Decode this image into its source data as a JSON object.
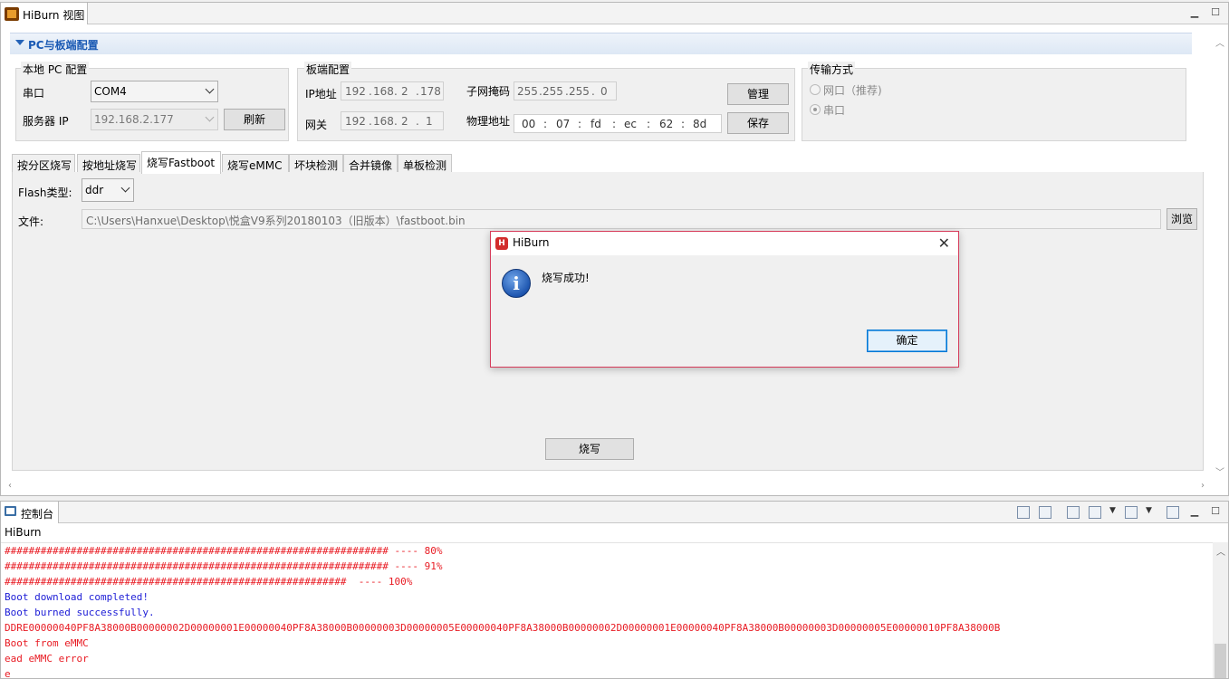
{
  "view": {
    "tab_title": "HiBurn 视图",
    "section_title": "PC与板端配置"
  },
  "local_pc": {
    "legend": "本地 PC 配置",
    "serial_label": "串口",
    "serial_value": "COM4",
    "server_ip_label": "服务器 IP",
    "server_ip_value": "192.168.2.177",
    "refresh_button": "刷新"
  },
  "board": {
    "legend": "板端配置",
    "ip_label": "IP地址",
    "ip": [
      "192",
      "168",
      "2",
      "178"
    ],
    "gateway_label": "网关",
    "gateway": [
      "192",
      "168",
      "2",
      "1"
    ],
    "subnet_label": "子网掩码",
    "subnet": [
      "255",
      "255",
      "255",
      "0"
    ],
    "mac_label": "物理地址",
    "mac": [
      "00",
      "07",
      "fd",
      "ec",
      "62",
      "8d"
    ],
    "manage_button": "管理",
    "save_button": "保存"
  },
  "transport": {
    "legend": "传输方式",
    "options": [
      {
        "label": "网口（推荐)",
        "selected": false
      },
      {
        "label": "串口",
        "selected": true
      }
    ]
  },
  "tabs": [
    "按分区烧写",
    "按地址烧写",
    "烧写Fastboot",
    "烧写eMMC",
    "坏块检测",
    "合并镜像",
    "单板检测"
  ],
  "selected_tab": "烧写Fastboot",
  "fastboot": {
    "flash_type_label": "Flash类型:",
    "flash_type_value": "ddr",
    "file_label": "文件:",
    "file_path": "C:\\Users\\Hanxue\\Desktop\\悦盒V9系列20180103（旧版本）\\fastboot.bin",
    "browse_button": "浏览",
    "burn_button": "烧写"
  },
  "dialog": {
    "title": "HiBurn",
    "message": "烧写成功!",
    "ok_button": "确定",
    "icon": "info-icon"
  },
  "console": {
    "tab_title": "控制台",
    "name": "HiBurn",
    "lines": [
      {
        "text": "################################################################ ---- 80%",
        "color": "red"
      },
      {
        "text": "################################################################ ---- 91%",
        "color": "red"
      },
      {
        "text": "#########################################################  ---- 100%",
        "color": "red"
      },
      {
        "text": "Boot download completed!",
        "color": "blue"
      },
      {
        "text": "Boot burned successfully.",
        "color": "blue"
      },
      {
        "text": "DDRE00000040PF8A38000B00000002D00000001E00000040PF8A38000B00000003D00000005E00000040PF8A38000B00000002D00000001E00000040PF8A38000B00000003D00000005E00000010PF8A38000B",
        "color": "red"
      },
      {
        "text": "Boot from eMMC",
        "color": "red"
      },
      {
        "text": "ead eMMC error",
        "color": "red"
      },
      {
        "text": "e",
        "color": "red"
      }
    ]
  },
  "colors": {
    "section_title": "#1b5ab4",
    "console_red": "#e81b23",
    "console_blue": "#1d1dd6",
    "dialog_border": "#d63b5a"
  }
}
